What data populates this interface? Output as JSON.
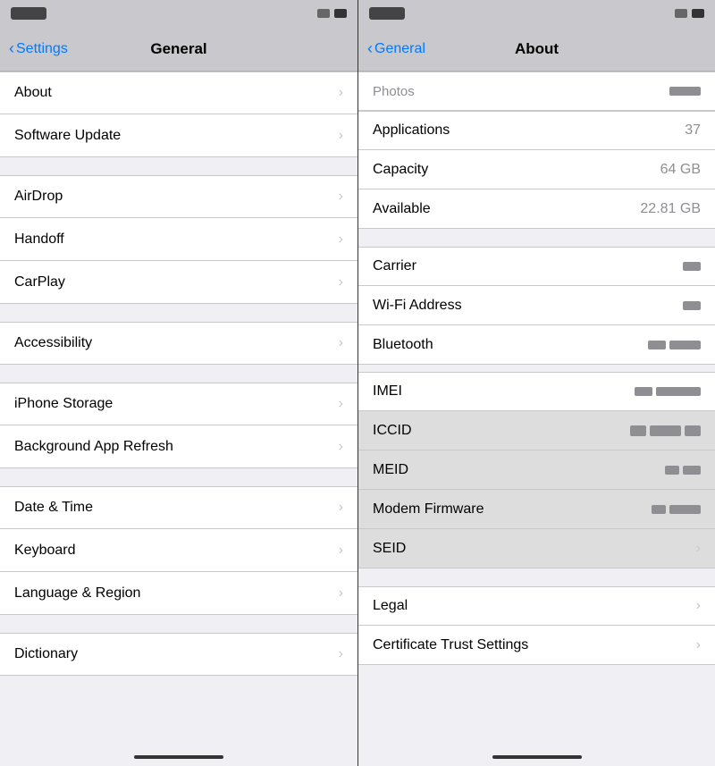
{
  "left_panel": {
    "status_bar": {
      "time": "time",
      "icon1": "square",
      "icon2": "square-dark"
    },
    "nav": {
      "back_label": "Settings",
      "title": "General"
    },
    "items_group1": [
      {
        "label": "About",
        "highlighted": true
      },
      {
        "label": "Software Update"
      }
    ],
    "items_group2": [
      {
        "label": "AirDrop"
      },
      {
        "label": "Handoff"
      },
      {
        "label": "CarPlay"
      }
    ],
    "items_group3": [
      {
        "label": "Accessibility"
      }
    ],
    "items_group4": [
      {
        "label": "iPhone Storage"
      },
      {
        "label": "Background App Refresh"
      }
    ],
    "items_group5": [
      {
        "label": "Date & Time"
      },
      {
        "label": "Keyboard"
      },
      {
        "label": "Language & Region"
      }
    ],
    "items_group6": [
      {
        "label": "Dictionary"
      }
    ]
  },
  "right_panel": {
    "status_bar": {
      "time": "time",
      "icon1": "square",
      "icon2": "square-dark"
    },
    "nav": {
      "back_label": "General",
      "title": "About"
    },
    "items": [
      {
        "label": "Applications",
        "value": "37",
        "has_chevron": false
      },
      {
        "label": "Capacity",
        "value": "64 GB",
        "has_chevron": false
      },
      {
        "label": "Available",
        "value": "22.81 GB",
        "has_chevron": false
      }
    ],
    "items2": [
      {
        "label": "Carrier",
        "value_blurred": true,
        "has_chevron": false
      },
      {
        "label": "Wi-Fi Address",
        "value_blurred": true,
        "has_chevron": false
      },
      {
        "label": "Bluetooth",
        "value_blurred": true,
        "has_chevron": false
      }
    ],
    "items3": [
      {
        "label": "IMEI",
        "value_blurred": true,
        "highlighted": true,
        "has_chevron": false
      },
      {
        "label": "ICCID",
        "value_blurred": true,
        "has_chevron": false
      },
      {
        "label": "MEID",
        "value_blurred": true,
        "has_chevron": false
      },
      {
        "label": "Modem Firmware",
        "value_blurred": true,
        "has_chevron": false
      },
      {
        "label": "SEID",
        "value": "",
        "has_chevron": true
      }
    ],
    "items4": [
      {
        "label": "Legal",
        "value": "",
        "has_chevron": true
      },
      {
        "label": "Certificate Trust Settings",
        "value": "",
        "has_chevron": true
      }
    ],
    "chevron_label": "›"
  },
  "icons": {
    "chevron": "›",
    "back_chevron": "‹"
  }
}
